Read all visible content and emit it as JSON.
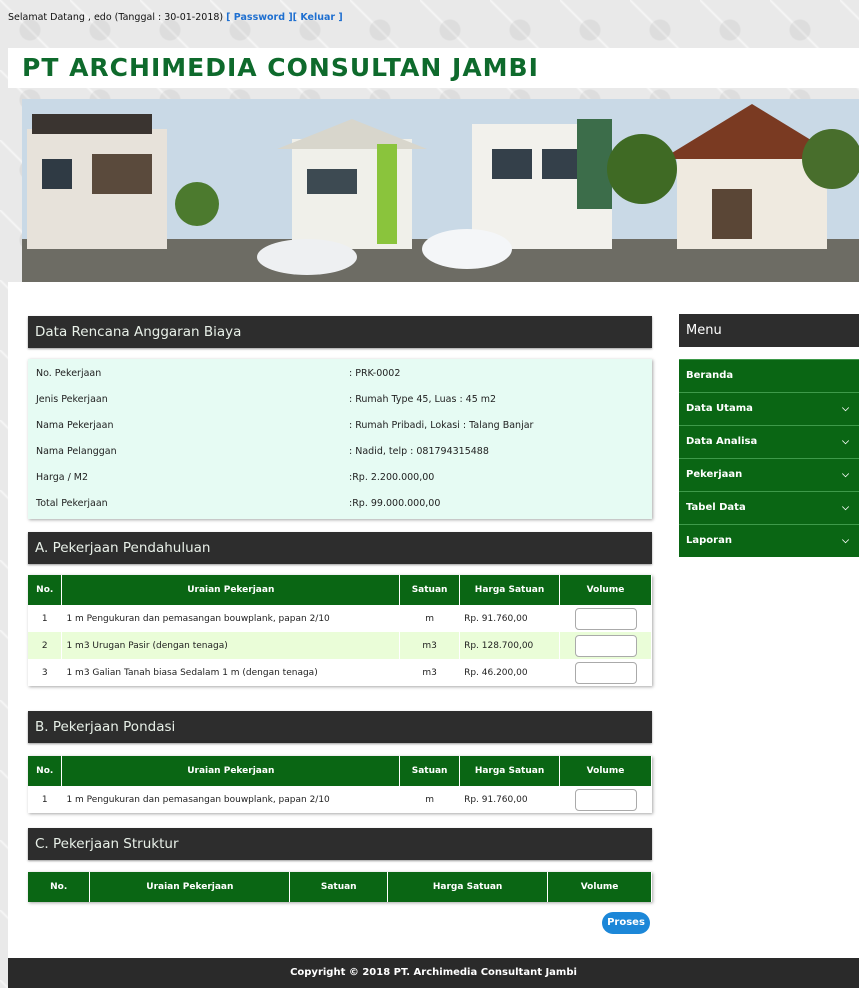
{
  "topbar": {
    "greeting": "Selamat Datang , edo (Tanggal : 30-01-2018)",
    "password_link": "[ Password ]",
    "logout_link": "[ Keluar ]"
  },
  "brand": {
    "title": "PT ARCHIMEDIA CONSULTAN JAMBI"
  },
  "main": {
    "page_title": "Data Rencana Anggaran Biaya",
    "info": [
      {
        "label": "No. Pekerjaan",
        "value": ": PRK-0002"
      },
      {
        "label": "Jenis Pekerjaan",
        "value": ": Rumah Type 45, Luas : 45 m2"
      },
      {
        "label": "Nama Pekerjaan",
        "value": ": Rumah Pribadi, Lokasi : Talang Banjar"
      },
      {
        "label": "Nama Pelanggan",
        "value": ": Nadid, telp : 081794315488"
      },
      {
        "label": "Harga / M2",
        "value": ":Rp. 2.200.000,00"
      },
      {
        "label": "Total Pekerjaan",
        "value": ":Rp. 99.000.000,00"
      }
    ],
    "columns": [
      "No.",
      "Uraian Pekerjaan",
      "Satuan",
      "Harga Satuan",
      "Volume"
    ],
    "sections": [
      {
        "title": "A. Pekerjaan Pendahuluan",
        "rows": [
          {
            "no": "1",
            "uraian": "1 m Pengukuran dan pemasangan bouwplank, papan 2/10",
            "satuan": "m",
            "harga": "Rp. 91.760,00"
          },
          {
            "no": "2",
            "uraian": "1 m3 Urugan Pasir (dengan tenaga)",
            "satuan": "m3",
            "harga": "Rp. 128.700,00"
          },
          {
            "no": "3",
            "uraian": "1 m3 Galian Tanah biasa Sedalam 1 m (dengan tenaga)",
            "satuan": "m3",
            "harga": "Rp. 46.200,00"
          }
        ]
      },
      {
        "title": "B. Pekerjaan Pondasi",
        "rows": [
          {
            "no": "1",
            "uraian": "1 m Pengukuran dan pemasangan bouwplank, papan 2/10",
            "satuan": "m",
            "harga": "Rp. 91.760,00"
          }
        ]
      },
      {
        "title": "C. Pekerjaan Struktur",
        "rows": []
      }
    ],
    "submit_label": "Proses"
  },
  "menu": {
    "title": "Menu",
    "items": [
      "Beranda",
      "Data Utama",
      "Data Analisa",
      "Pekerjaan",
      "Tabel Data",
      "Laporan"
    ]
  },
  "footer": {
    "text": "Copyright © 2018 PT. Archimedia Consultant Jambi"
  },
  "colors": {
    "accent_green": "#0a6614",
    "dark_header": "#2d2d2d",
    "info_bg": "#e6fbf3",
    "alt_row": "#eafdd8",
    "button_blue": "#1c87d8"
  },
  "icons": {
    "menu_expand": "chevron-down-icon"
  }
}
